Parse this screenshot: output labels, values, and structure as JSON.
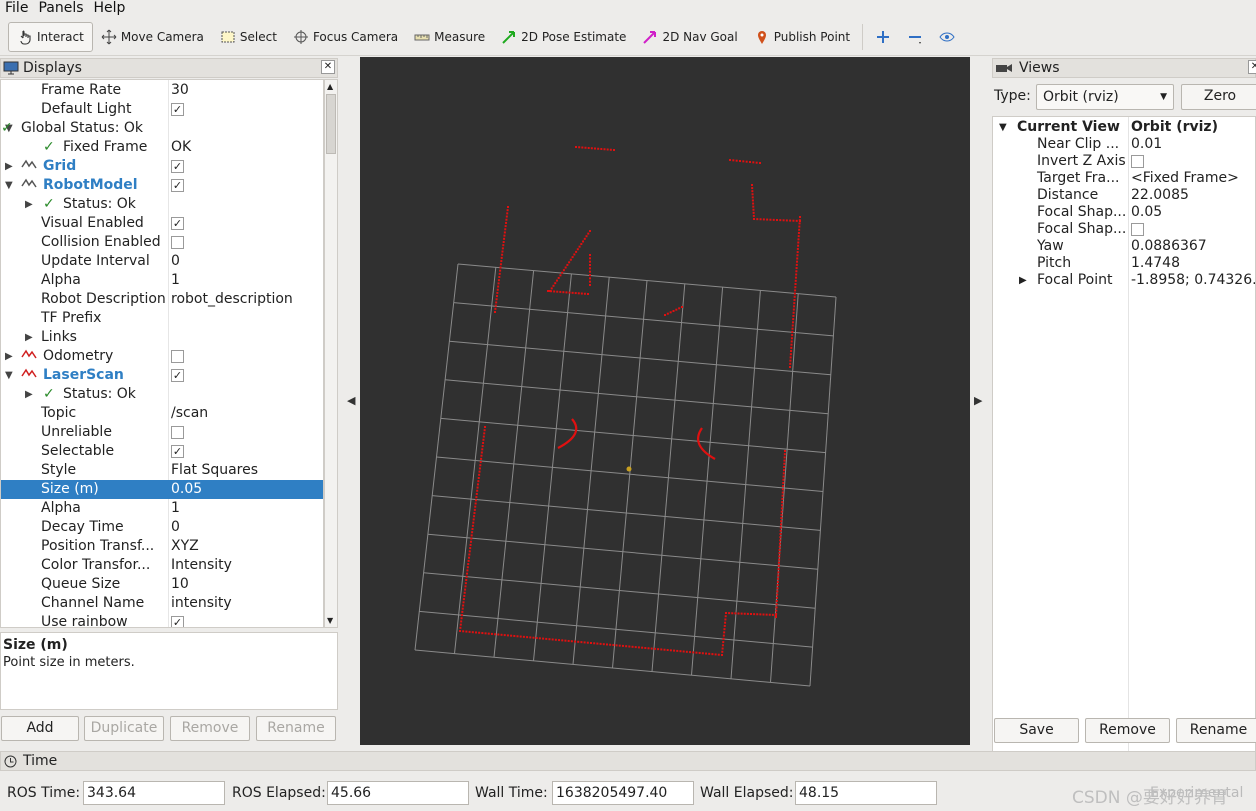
{
  "menu": {
    "file": "File",
    "panels": "Panels",
    "help": "Help"
  },
  "toolbar": {
    "interact": "Interact",
    "move_camera": "Move Camera",
    "select": "Select",
    "focus_camera": "Focus Camera",
    "measure": "Measure",
    "pose_estimate": "2D Pose Estimate",
    "nav_goal": "2D Nav Goal",
    "publish_point": "Publish Point"
  },
  "displays": {
    "title": "Displays",
    "rows": [
      {
        "key": "Frame Rate",
        "value": "30"
      },
      {
        "key": "Default Light",
        "value": "✓"
      },
      {
        "key": "Global Status: Ok",
        "value": ""
      },
      {
        "key": "Fixed Frame",
        "value": "OK"
      },
      {
        "key": "Grid",
        "value": "✓"
      },
      {
        "key": "RobotModel",
        "value": "✓"
      },
      {
        "key": "Status: Ok",
        "value": ""
      },
      {
        "key": "Visual Enabled",
        "value": "✓"
      },
      {
        "key": "Collision Enabled",
        "value": ""
      },
      {
        "key": "Update Interval",
        "value": "0"
      },
      {
        "key": "Alpha",
        "value": "1"
      },
      {
        "key": "Robot Description",
        "value": "robot_description"
      },
      {
        "key": "TF Prefix",
        "value": ""
      },
      {
        "key": "Links",
        "value": ""
      },
      {
        "key": "Odometry",
        "value": ""
      },
      {
        "key": "LaserScan",
        "value": "✓"
      },
      {
        "key": "Status: Ok",
        "value": ""
      },
      {
        "key": "Topic",
        "value": "/scan"
      },
      {
        "key": "Unreliable",
        "value": ""
      },
      {
        "key": "Selectable",
        "value": "✓"
      },
      {
        "key": "Style",
        "value": "Flat Squares"
      },
      {
        "key": "Size (m)",
        "value": "0.05"
      },
      {
        "key": "Alpha",
        "value": "1"
      },
      {
        "key": "Decay Time",
        "value": "0"
      },
      {
        "key": "Position Transf...",
        "value": "XYZ"
      },
      {
        "key": "Color Transfor...",
        "value": "Intensity"
      },
      {
        "key": "Queue Size",
        "value": "10"
      },
      {
        "key": "Channel Name",
        "value": "intensity"
      },
      {
        "key": "Use rainbow",
        "value": "✓"
      }
    ],
    "selected_row": "Size (m)",
    "desc_title": "Size (m)",
    "desc_text": "Point size in meters.",
    "buttons": {
      "add": "Add",
      "duplicate": "Duplicate",
      "remove": "Remove",
      "rename": "Rename"
    }
  },
  "views": {
    "title": "Views",
    "type_label": "Type:",
    "type_value": "Orbit (rviz)",
    "zero": "Zero",
    "current_view": "Current View",
    "current_value": "Orbit (rviz)",
    "rows": [
      {
        "key": "Near Clip ...",
        "value": "0.01"
      },
      {
        "key": "Invert Z Axis",
        "value": ""
      },
      {
        "key": "Target Fra...",
        "value": "<Fixed Frame>"
      },
      {
        "key": "Distance",
        "value": "22.0085"
      },
      {
        "key": "Focal Shap...",
        "value": "0.05"
      },
      {
        "key": "Focal Shap...",
        "value": ""
      },
      {
        "key": "Yaw",
        "value": "0.0886367"
      },
      {
        "key": "Pitch",
        "value": "1.4748"
      },
      {
        "key": "Focal Point",
        "value": "-1.8958; 0.74326..."
      }
    ],
    "buttons": {
      "save": "Save",
      "remove": "Remove",
      "rename": "Rename"
    }
  },
  "time": {
    "title": "Time",
    "ros_time_label": "ROS Time:",
    "ros_time": "343.64",
    "ros_elapsed_label": "ROS Elapsed:",
    "ros_elapsed": "45.66",
    "wall_time_label": "Wall Time:",
    "wall_time": "1638205497.40",
    "wall_elapsed_label": "Wall Elapsed:",
    "wall_elapsed": "48.15",
    "experimental": "Experimental"
  },
  "watermark": "CSDN @要好好养胃",
  "colors": {
    "selection": "#2f7fc4",
    "viewport_bg": "#303030",
    "laser": "#e01010",
    "grid": "#8a8a8a"
  }
}
